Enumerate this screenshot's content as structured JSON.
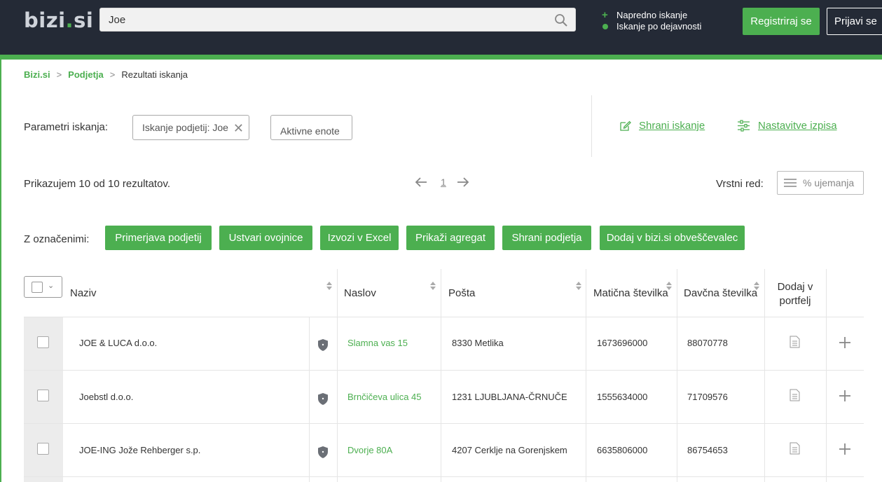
{
  "header": {
    "logo_main": "bizi",
    "logo_dot": ".",
    "logo_tld": "si",
    "search_value": "Joe",
    "advanced_search": "Napredno iskanje",
    "activity_search": "Iskanje po dejavnosti",
    "register_label": "Registriraj se",
    "login_label": "Prijavi se"
  },
  "breadcrumb": {
    "home": "Bizi.si",
    "sep1": ">",
    "companies": "Podjetja",
    "sep2": ">",
    "current": "Rezultati iskanja"
  },
  "params": {
    "label": "Parametri iskanja:",
    "chip_query": "Iskanje podjetij: Joe",
    "chip_remove": "✕",
    "chip_active": "Aktivne enote",
    "save_search": "Shrani iskanje",
    "print_settings": "Nastavitve izpisa"
  },
  "results": {
    "count_text": "Prikazujem 10 od 10 rezultatov.",
    "page": "1",
    "order_label": "Vrstni red:",
    "order_value": "% ujemanja"
  },
  "bulk": {
    "label": "Z označenimi:",
    "actions": [
      "Primerjava podjetij",
      "Ustvari ovojnice",
      "Izvozi v Excel",
      "Prikaži agregat",
      "Shrani podjetja",
      "Dodaj v bizi.si obveščevalec"
    ]
  },
  "table": {
    "columns": {
      "name": "Naziv",
      "address": "Naslov",
      "post": "Pošta",
      "reg_number": "Matična številka",
      "tax_number": "Davčna številka",
      "portfolio": "Dodaj v portfelj"
    },
    "rows": [
      {
        "name": "JOE & LUCA d.o.o.",
        "address": "Slamna vas 15",
        "post": "8330 Metlika",
        "reg_number": "1673696000",
        "tax_number": "88070778"
      },
      {
        "name": "Joebstl d.o.o.",
        "address": "Brnčičeva ulica 45",
        "post": "1231 LJUBLJANA-ČRNUČE",
        "reg_number": "1555634000",
        "tax_number": "71709576"
      },
      {
        "name": "JOE-ING Jože Rehberger s.p.",
        "address": "Dvorje 80A",
        "post": "4207 Cerklje na Gorenjskem",
        "reg_number": "6635806000",
        "tax_number": "86754653"
      }
    ]
  },
  "icons": {
    "search": "magnifier-icon",
    "edit": "pencil-icon",
    "settings": "sliders-icon",
    "shield": "shield-icon",
    "document": "document-icon",
    "add": "plus-icon"
  },
  "colors": {
    "brand_green": "#4caf50",
    "header_bg": "#242a36"
  }
}
